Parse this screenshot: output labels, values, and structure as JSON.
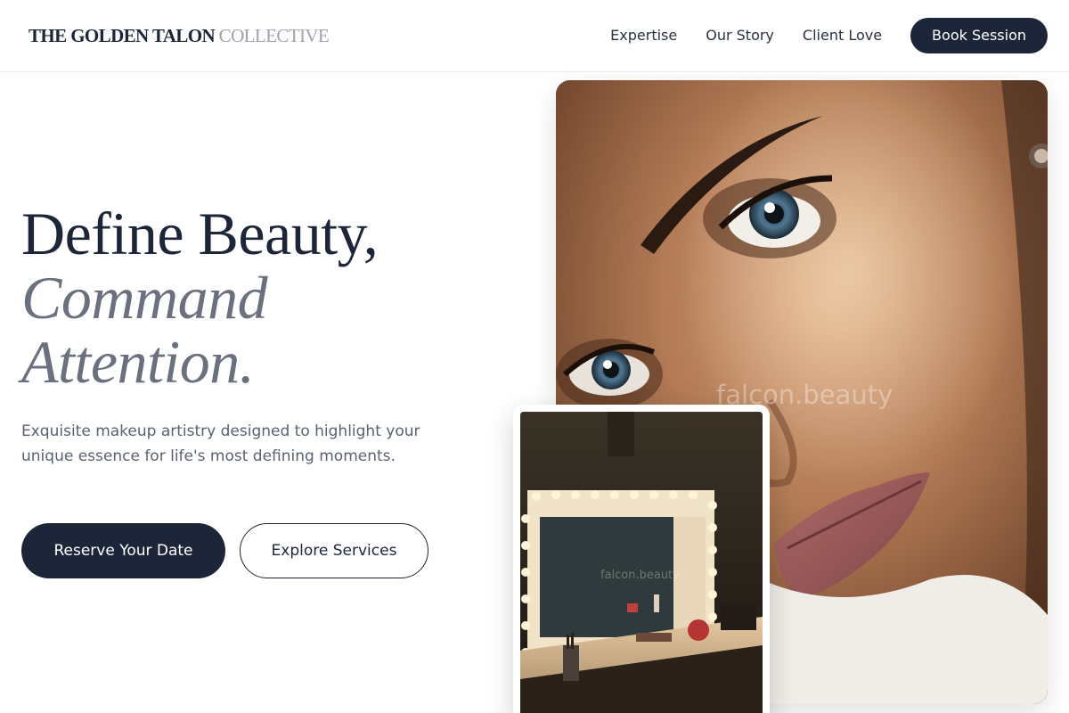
{
  "header": {
    "logo_primary": "THE GOLDEN TALON",
    "logo_secondary": "COLLECTIVE",
    "nav": [
      "Expertise",
      "Our Story",
      "Client Love"
    ],
    "cta_label": "Book Session"
  },
  "hero": {
    "headline_line1": "Define Beauty,",
    "headline_line2": "Command",
    "headline_line3": "Attention.",
    "subtext": "Exquisite makeup artistry designed to highlight your unique essence for life's most defining moments.",
    "primary_button": "Reserve Your Date",
    "secondary_button": "Explore Services"
  },
  "images": {
    "portrait_watermark": "falcon.beauty",
    "vanity_watermark": "falcon.beauty"
  },
  "colors": {
    "primary": "#1c2638",
    "muted_headline": "#6b707e",
    "logo_light": "#9ea3ab"
  }
}
